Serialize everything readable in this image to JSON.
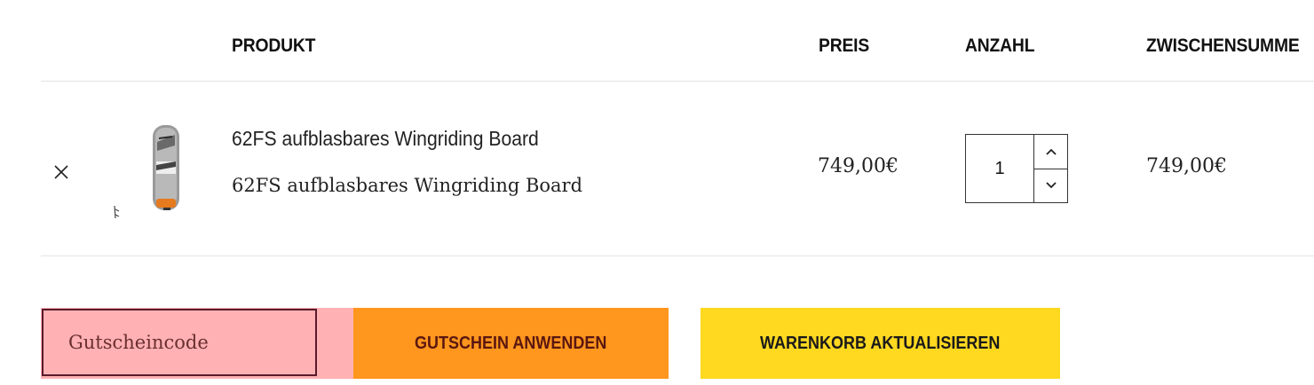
{
  "table_header": {
    "product": "PRODUKT",
    "price": "PREIS",
    "quantity": "ANZAHL",
    "subtotal": "ZWISCHENSUMME"
  },
  "cart_item": {
    "name": "62FS aufblasbares Wingriding Board",
    "description": "62FS aufblasbares Wingriding Board",
    "price": "749,00€",
    "quantity": "1",
    "subtotal": "749,00€",
    "remove_icon": "close-icon",
    "thumbnail": "wingboard-product-image"
  },
  "coupon": {
    "placeholder": "Gutscheincode",
    "value": ""
  },
  "actions": {
    "apply_coupon_label": "GUTSCHEIN ANWENDEN",
    "update_cart_label": "WARENKORB AKTUALISIEREN"
  },
  "colors": {
    "coupon_bg": "#ffb1b4",
    "apply_button_bg": "#ff961e",
    "update_button_bg": "#ffd820"
  }
}
